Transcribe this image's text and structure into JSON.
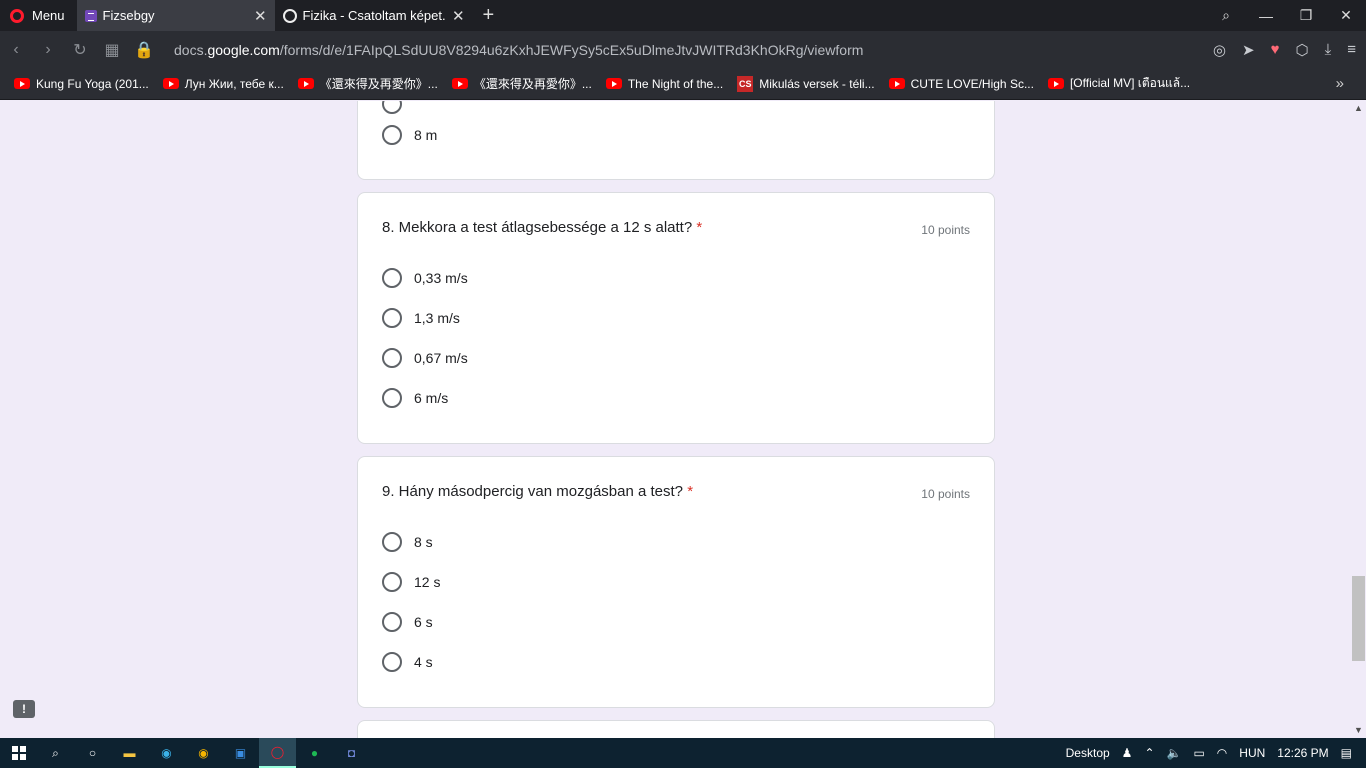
{
  "tabs": {
    "menu_label": "Menu",
    "active_title": "Fizsebgy",
    "second_title": "Fizika - Csatoltam képet."
  },
  "address": {
    "url_prefix": "docs.",
    "url_domain": "google.com",
    "url_path": "/forms/d/e/1FAIpQLSdUU8V8294u6zKxhJEWFySy5cEx5uDlmeJtvJWITRd3KhOkRg/viewform"
  },
  "bookmarks": [
    "Kung Fu Yoga (201...",
    "Лун Жии, тебе к...",
    "《還來得及再愛你》...",
    "《還來得及再愛你》...",
    "The Night of the...",
    "Mikulás versek - téli...",
    "CUTE LOVE/High Sc...",
    "[Official MV] เตือนแล้..."
  ],
  "prev_question": {
    "last_option": "8 m"
  },
  "questions": [
    {
      "title": "8. Mekkora a test átlagsebessége a 12 s alatt?",
      "required_mark": "*",
      "points": "10 points",
      "options": [
        "0,33 m/s",
        "1,3 m/s",
        "0,67 m/s",
        "6 m/s"
      ]
    },
    {
      "title": "9. Hány másodpercig van mozgásban a test?",
      "required_mark": "*",
      "points": "10 points",
      "options": [
        "8 s",
        "12 s",
        "6 s",
        "4 s"
      ]
    }
  ],
  "taskbar": {
    "desktop_label": "Desktop",
    "lang": "HUN",
    "time": "12:26 PM"
  }
}
